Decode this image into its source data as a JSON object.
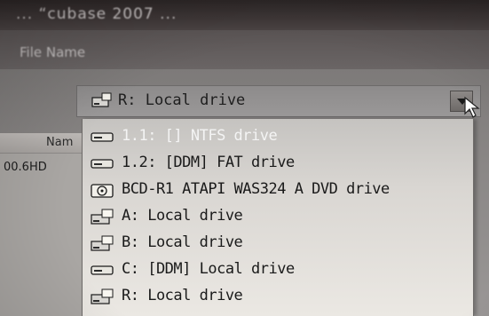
{
  "window": {
    "title": "...  “cubase 2007  ...",
    "menu_label": "File Name"
  },
  "list_header": {
    "column": "Nam"
  },
  "list_cell": {
    "value": "00.6HD"
  },
  "combo": {
    "selected": "R: Local drive",
    "icon": "hard-drive-icon"
  },
  "dropdown": {
    "items": [
      {
        "label": "1.1: [] NTFS drive",
        "icon": "hard-drive-icon",
        "selected": true
      },
      {
        "label": "1.2: [DDM] FAT drive",
        "icon": "hard-drive-icon",
        "selected": false
      },
      {
        "label": "BCD-R1 ATAPI  WAS324  A    DVD drive",
        "icon": "cd-drive-icon",
        "selected": false
      },
      {
        "label": "A: Local drive",
        "icon": "network-drive-icon",
        "selected": false
      },
      {
        "label": "B: Local drive",
        "icon": "network-drive-icon",
        "selected": false
      },
      {
        "label": "C: [DDM] Local drive",
        "icon": "hard-drive-icon",
        "selected": false
      },
      {
        "label": "R: Local drive",
        "icon": "network-drive-icon",
        "selected": false
      }
    ]
  },
  "colors": {
    "dropdown_bg": "#d9d6d2",
    "selected_text": "#f4f4f4",
    "text": "#1a1a1a"
  }
}
